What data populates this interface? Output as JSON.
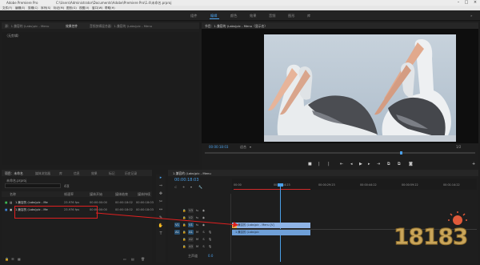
{
  "window": {
    "title": "Adobe Premiere Pro",
    "path": "C:\\Users\\Administrator\\Documents\\Adobe\\Premiere Pro\\1.4\\未命名.prproj"
  },
  "menu": [
    "文件(F)",
    "编辑(E)",
    "剪辑(C)",
    "序列(S)",
    "标记(M)",
    "图形(G)",
    "视图(V)",
    "窗口(W)",
    "帮助(H)"
  ],
  "workspaces": [
    "组件",
    "编辑",
    "颜色",
    "效果",
    "音频",
    "图形",
    "库"
  ],
  "active_workspace": "编辑",
  "source_panel": {
    "tabs": [
      "源：1.兼容的 (Labs)pic - Menu",
      "效果控件",
      "音频剪辑混合器：1.兼容的 (Labs)pic - Menu"
    ],
    "empty_label": "（无剪辑）"
  },
  "program_panel": {
    "tab": "节目：1.兼容的 (Labs)pic - Menu（显示名）",
    "timecode": "00:00:18:03",
    "fit": "适合",
    "scale": "1/2"
  },
  "project_panel": {
    "tabs": [
      "项目：未命名",
      "媒体浏览器",
      "库",
      "信息",
      "效果",
      "标记",
      "历史记录"
    ],
    "project_file": "未命名.prproj",
    "count": "4项",
    "columns": [
      "名称",
      "帧速率",
      "媒体开始",
      "媒体结束",
      "媒体持续"
    ],
    "items": [
      {
        "name": "1.兼容的 (Labs)pic - Me",
        "fps": "23.976 fps",
        "start": "00:00:00:00",
        "end": "00:00:18:02",
        "dur": "00:00:18:03"
      },
      {
        "name": "1.兼容的 (Labs)pic - Me",
        "fps": "23.976 fps",
        "start": "00:00:00:00",
        "end": "00:00:18:02",
        "dur": "00:00:18:03"
      }
    ]
  },
  "timeline": {
    "tab": "1.兼容的 (Labs)pic - Menu",
    "timecode": "00:00:18:03",
    "ruler": [
      "00:00",
      "00:00:14:23",
      "00:00:29:23",
      "00:00:44:22",
      "00:00:59:22",
      "00:01:14:22"
    ],
    "video_tracks": [
      "V3",
      "V2",
      "V1"
    ],
    "audio_tracks": [
      "A1",
      "A2",
      "A3"
    ],
    "master": "主声道",
    "master_value": "0.0",
    "clip_video": "1.兼容的 (Labs)pic - Menu [V]",
    "clip_audio": "1.兼容的 (Labs)pic"
  },
  "watermark": "18183",
  "colors": {
    "accent": "#4a9fe8",
    "clip": "#8fb4e6",
    "arrow": "#e02020",
    "watermark": "#c9a55a"
  }
}
